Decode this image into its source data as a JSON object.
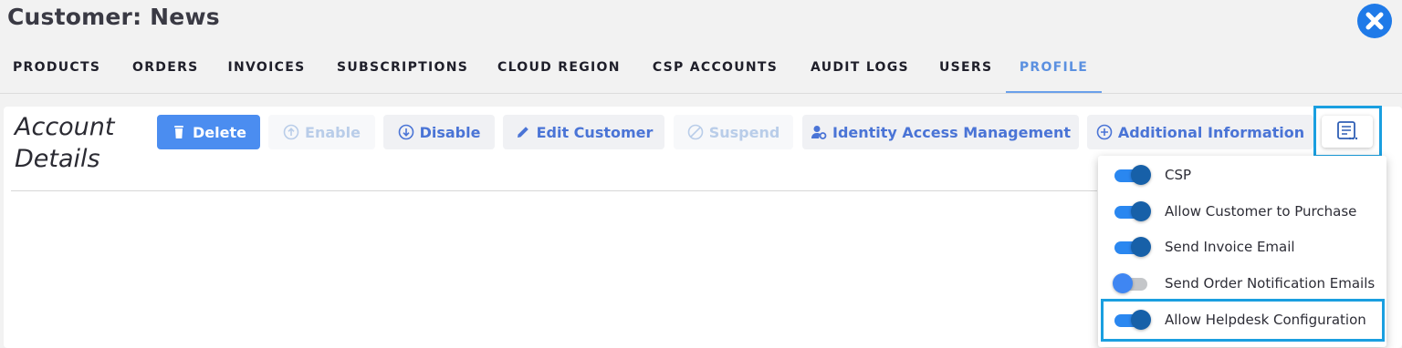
{
  "header": {
    "title": "Customer: News",
    "close_icon": "close-circle-icon",
    "accent": "#1f7ae8"
  },
  "tabs": [
    {
      "label": "PRODUCTS"
    },
    {
      "label": "ORDERS"
    },
    {
      "label": "INVOICES"
    },
    {
      "label": "SUBSCRIPTIONS"
    },
    {
      "label": "CLOUD REGION"
    },
    {
      "label": "CSP ACCOUNTS"
    },
    {
      "label": "AUDIT LOGS"
    },
    {
      "label": "USERS"
    },
    {
      "label": "PROFILE",
      "active": true
    }
  ],
  "section": {
    "title_line1": "Account",
    "title_line2": "Details"
  },
  "toolbar": {
    "delete": {
      "label": "Delete",
      "icon": "trash-icon"
    },
    "enable": {
      "label": "Enable",
      "icon": "arrow-up-circle-icon",
      "disabled": true
    },
    "disable": {
      "label": "Disable",
      "icon": "arrow-down-circle-icon"
    },
    "edit_customer": {
      "label": "Edit Customer",
      "icon": "pencil-icon"
    },
    "suspend": {
      "label": "Suspend",
      "icon": "ban-icon",
      "disabled": true
    },
    "iam": {
      "label": "Identity Access Management",
      "icon": "user-gear-icon"
    },
    "additional_info": {
      "label": "Additional Information",
      "icon": "plus-circle-icon"
    },
    "menu_icon": "list-menu-icon"
  },
  "dropdown": {
    "items": [
      {
        "label": "CSP",
        "on": true
      },
      {
        "label": "Allow Customer to Purchase",
        "on": true
      },
      {
        "label": "Send Invoice Email",
        "on": true
      },
      {
        "label": "Send Order Notification Emails",
        "on": false
      },
      {
        "label": "Allow Helpdesk Configuration",
        "on": true
      }
    ]
  },
  "colors": {
    "primary_button": "#4b8df0",
    "button_text": "#4a74d6",
    "highlight": "#1a9fe0",
    "toggle_on": "#1760a8"
  }
}
